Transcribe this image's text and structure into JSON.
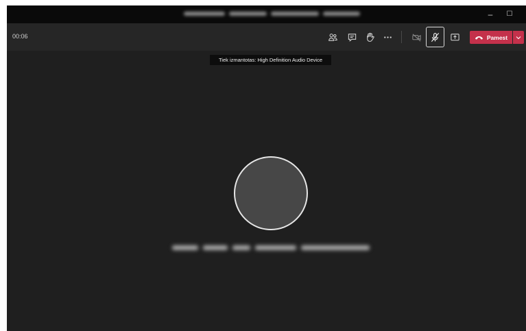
{
  "window": {
    "title_redacted": true,
    "controls": {
      "minimize": "–",
      "maximize": "☐",
      "close": "✕"
    }
  },
  "toolbar": {
    "timer": "00:06",
    "buttons": [
      {
        "name": "participants-icon",
        "icon": "people"
      },
      {
        "name": "chat-icon",
        "icon": "chat"
      },
      {
        "name": "raise-hand-icon",
        "icon": "hand"
      },
      {
        "name": "more-options-icon",
        "icon": "ellipsis"
      },
      {
        "name": "camera-off-icon",
        "icon": "video-off"
      },
      {
        "name": "mic-muted-icon",
        "icon": "mic-off",
        "active": true
      },
      {
        "name": "share-screen-icon",
        "icon": "share"
      }
    ],
    "leave_label": "Pamest",
    "leave_color": "#c4314b"
  },
  "tooltip": {
    "text": "Tiek izmantotas: High Definition Audio Device"
  },
  "main": {
    "avatar": "avatar",
    "status_redacted": true
  },
  "colors": {
    "background": "#1f1f1f",
    "toolbar": "#262626",
    "titlebar": "#0a0a0a",
    "accent": "#c4314b"
  }
}
